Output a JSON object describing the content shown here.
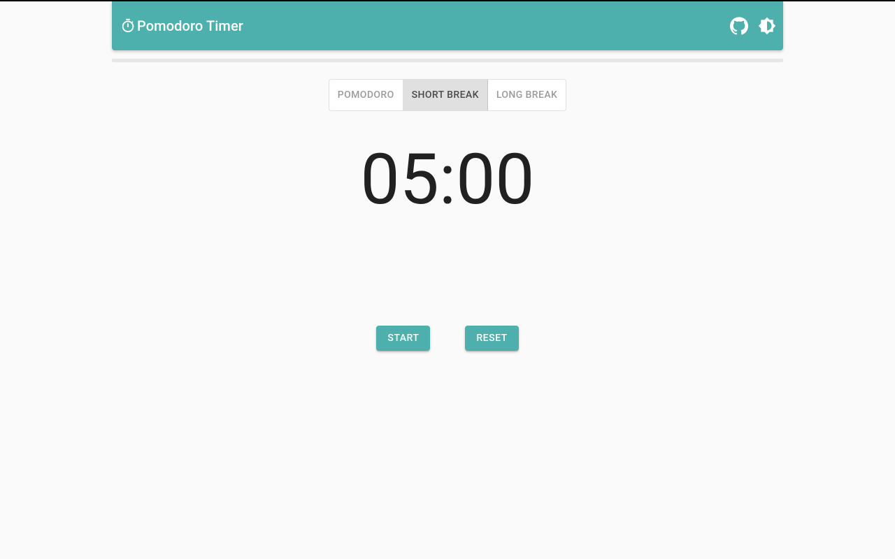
{
  "header": {
    "title": "Pomodoro Timer",
    "icons": {
      "timer": "timer-icon",
      "github": "github-icon",
      "theme": "theme-toggle-icon"
    }
  },
  "tabs": [
    {
      "label": "POMODORO",
      "active": false
    },
    {
      "label": "SHORT BREAK",
      "active": true
    },
    {
      "label": "LONG BREAK",
      "active": false
    }
  ],
  "timer": {
    "display": "05:00"
  },
  "controls": {
    "start_label": "START",
    "reset_label": "RESET"
  },
  "colors": {
    "primary": "#4db0ac",
    "tab_active_bg": "#e0e0e0",
    "text_dark": "#212121"
  }
}
